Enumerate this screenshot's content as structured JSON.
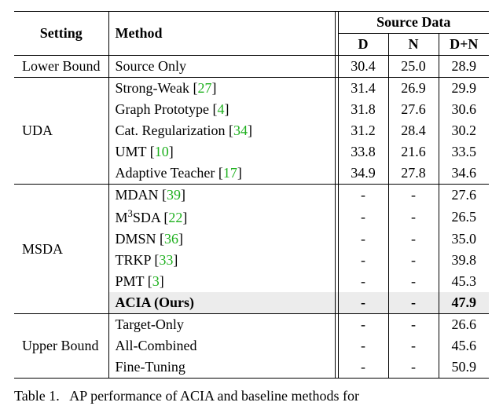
{
  "header": {
    "setting": "Setting",
    "method": "Method",
    "sourceData": "Source Data",
    "D": "D",
    "N": "N",
    "DN": "D+N"
  },
  "groups": [
    {
      "setting": "Lower Bound",
      "rows": [
        {
          "method": "Source Only",
          "ref": "",
          "D": "30.4",
          "N": "25.0",
          "DN": "28.9"
        }
      ]
    },
    {
      "setting": "UDA",
      "rows": [
        {
          "method": "Strong-Weak",
          "ref": "27",
          "D": "31.4",
          "N": "26.9",
          "DN": "29.9"
        },
        {
          "method": "Graph Prototype",
          "ref": "4",
          "D": "31.8",
          "N": "27.6",
          "DN": "30.6"
        },
        {
          "method": "Cat. Regularization",
          "ref": "34",
          "D": "31.2",
          "N": "28.4",
          "DN": "30.2"
        },
        {
          "method": "UMT",
          "ref": "10",
          "D": "33.8",
          "N": "21.6",
          "DN": "33.5"
        },
        {
          "method": "Adaptive Teacher",
          "ref": "17",
          "D": "34.9",
          "N": "27.8",
          "DN": "34.6"
        }
      ]
    },
    {
      "setting": "MSDA",
      "rows": [
        {
          "method": "MDAN",
          "ref": "39",
          "D": "-",
          "N": "-",
          "DN": "27.6"
        },
        {
          "method_html": "M<sup>3</sup>SDA",
          "method": "M3SDA",
          "ref": "22",
          "D": "-",
          "N": "-",
          "DN": "26.5"
        },
        {
          "method": "DMSN",
          "ref": "36",
          "D": "-",
          "N": "-",
          "DN": "35.0"
        },
        {
          "method": "TRKP",
          "ref": "33",
          "D": "-",
          "N": "-",
          "DN": "39.8"
        },
        {
          "method": "PMT",
          "ref": "3",
          "D": "-",
          "N": "-",
          "DN": "45.3"
        },
        {
          "method": "ACIA (Ours)",
          "ref": "",
          "D": "-",
          "N": "-",
          "DN": "47.9",
          "highlight": true,
          "bold": true
        }
      ]
    },
    {
      "setting": "Upper Bound",
      "rows": [
        {
          "method": "Target-Only",
          "ref": "",
          "D": "-",
          "N": "-",
          "DN": "26.6"
        },
        {
          "method": "All-Combined",
          "ref": "",
          "D": "-",
          "N": "-",
          "DN": "45.6"
        },
        {
          "method": "Fine-Tuning",
          "ref": "",
          "D": "-",
          "N": "-",
          "DN": "50.9"
        }
      ]
    }
  ],
  "caption": {
    "labelPrefix": "Table 1.",
    "textFragment": "AP performance of ACIA and baseline methods for"
  },
  "chart_data": {
    "type": "table",
    "columns": [
      "Setting",
      "Method",
      "D",
      "N",
      "D+N"
    ],
    "rows": [
      [
        "Lower Bound",
        "Source Only",
        30.4,
        25.0,
        28.9
      ],
      [
        "UDA",
        "Strong-Weak [27]",
        31.4,
        26.9,
        29.9
      ],
      [
        "UDA",
        "Graph Prototype [4]",
        31.8,
        27.6,
        30.6
      ],
      [
        "UDA",
        "Cat. Regularization [34]",
        31.2,
        28.4,
        30.2
      ],
      [
        "UDA",
        "UMT [10]",
        33.8,
        21.6,
        33.5
      ],
      [
        "UDA",
        "Adaptive Teacher [17]",
        34.9,
        27.8,
        34.6
      ],
      [
        "MSDA",
        "MDAN [39]",
        null,
        null,
        27.6
      ],
      [
        "MSDA",
        "M3SDA [22]",
        null,
        null,
        26.5
      ],
      [
        "MSDA",
        "DMSN [36]",
        null,
        null,
        35.0
      ],
      [
        "MSDA",
        "TRKP [33]",
        null,
        null,
        39.8
      ],
      [
        "MSDA",
        "PMT [3]",
        null,
        null,
        45.3
      ],
      [
        "MSDA",
        "ACIA (Ours)",
        null,
        null,
        47.9
      ],
      [
        "Upper Bound",
        "Target-Only",
        null,
        null,
        26.6
      ],
      [
        "Upper Bound",
        "All-Combined",
        null,
        null,
        45.6
      ],
      [
        "Upper Bound",
        "Fine-Tuning",
        null,
        null,
        50.9
      ]
    ]
  }
}
